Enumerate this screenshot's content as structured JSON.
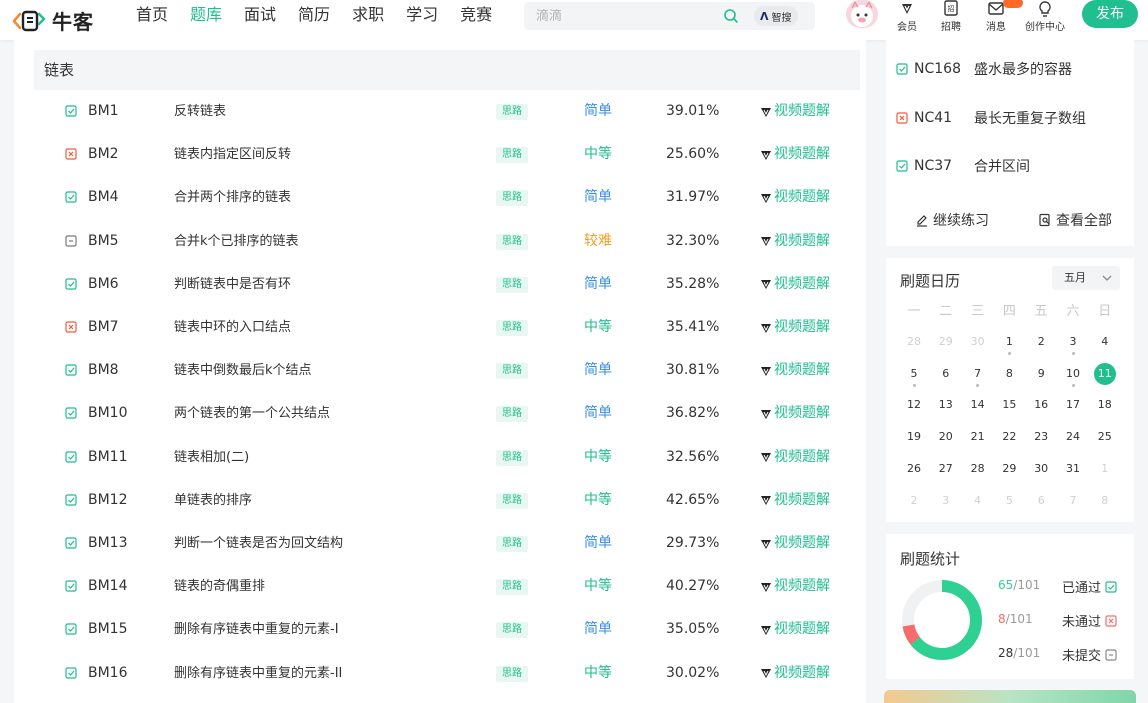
{
  "header": {
    "logo_text": "牛客",
    "nav": [
      {
        "label": "首页",
        "active": false
      },
      {
        "label": "题库",
        "active": true
      },
      {
        "label": "面试",
        "active": false
      },
      {
        "label": "简历",
        "active": false
      },
      {
        "label": "求职",
        "active": false
      },
      {
        "label": "学习",
        "active": false
      },
      {
        "label": "竞赛",
        "active": false
      }
    ],
    "search_placeholder": "滴滴",
    "zhisou_label": "智搜",
    "tools": {
      "vip": "会员",
      "recruit": "招聘",
      "message": "消息",
      "creator": "创作中心"
    },
    "publish_label": "发布",
    "accent": "#1fbf8f"
  },
  "list": {
    "section_title": "链表",
    "tag_label": "思路",
    "video_label": "视频题解",
    "rows": [
      {
        "status": "done",
        "id": "BM1",
        "title": "反转链表",
        "difficulty": "简单",
        "rate": "39.01%"
      },
      {
        "status": "fail",
        "id": "BM2",
        "title": "链表内指定区间反转",
        "difficulty": "中等",
        "rate": "25.60%"
      },
      {
        "status": "done",
        "id": "BM4",
        "title": "合并两个排序的链表",
        "difficulty": "简单",
        "rate": "31.97%"
      },
      {
        "status": "none",
        "id": "BM5",
        "title": "合并k个已排序的链表",
        "difficulty": "较难",
        "rate": "32.30%"
      },
      {
        "status": "done",
        "id": "BM6",
        "title": "判断链表中是否有环",
        "difficulty": "简单",
        "rate": "35.28%"
      },
      {
        "status": "fail",
        "id": "BM7",
        "title": "链表中环的入口结点",
        "difficulty": "中等",
        "rate": "35.41%"
      },
      {
        "status": "done",
        "id": "BM8",
        "title": "链表中倒数最后k个结点",
        "difficulty": "简单",
        "rate": "30.81%"
      },
      {
        "status": "done",
        "id": "BM10",
        "title": "两个链表的第一个公共结点",
        "difficulty": "简单",
        "rate": "36.82%"
      },
      {
        "status": "done",
        "id": "BM11",
        "title": "链表相加(二)",
        "difficulty": "中等",
        "rate": "32.56%"
      },
      {
        "status": "done",
        "id": "BM12",
        "title": "单链表的排序",
        "difficulty": "中等",
        "rate": "42.65%"
      },
      {
        "status": "done",
        "id": "BM13",
        "title": "判断一个链表是否为回文结构",
        "difficulty": "简单",
        "rate": "29.73%"
      },
      {
        "status": "done",
        "id": "BM14",
        "title": "链表的奇偶重排",
        "difficulty": "中等",
        "rate": "40.27%"
      },
      {
        "status": "done",
        "id": "BM15",
        "title": "删除有序链表中重复的元素-I",
        "difficulty": "简单",
        "rate": "35.05%"
      },
      {
        "status": "done",
        "id": "BM16",
        "title": "删除有序链表中重复的元素-II",
        "difficulty": "中等",
        "rate": "30.02%"
      }
    ],
    "difficulty_colors": {
      "简单": "#3a8ee6",
      "中等": "#1fbf8f",
      "较难": "#f0a020"
    }
  },
  "recommend": {
    "items": [
      {
        "status": "done",
        "id": "NC168",
        "title": "盛水最多的容器"
      },
      {
        "status": "fail",
        "id": "NC41",
        "title": "最长无重复子数组"
      },
      {
        "status": "done",
        "id": "NC37",
        "title": "合并区间"
      }
    ],
    "continue_label": "继续练习",
    "view_all_label": "查看全部"
  },
  "calendar": {
    "title": "刷题日历",
    "month": "五月",
    "weekdays": [
      "一",
      "二",
      "三",
      "四",
      "五",
      "六",
      "日"
    ],
    "weeks": [
      [
        {
          "d": "28",
          "dim": true
        },
        {
          "d": "29",
          "dim": true
        },
        {
          "d": "30",
          "dim": true
        },
        {
          "d": "1",
          "dot": true
        },
        {
          "d": "2"
        },
        {
          "d": "3",
          "dot": true
        },
        {
          "d": "4"
        }
      ],
      [
        {
          "d": "5",
          "dot": true
        },
        {
          "d": "6"
        },
        {
          "d": "7",
          "dot": true
        },
        {
          "d": "8"
        },
        {
          "d": "9"
        },
        {
          "d": "10",
          "dot": true
        },
        {
          "d": "11",
          "today": true
        }
      ],
      [
        {
          "d": "12"
        },
        {
          "d": "13"
        },
        {
          "d": "14"
        },
        {
          "d": "15"
        },
        {
          "d": "16"
        },
        {
          "d": "17"
        },
        {
          "d": "18"
        }
      ],
      [
        {
          "d": "19"
        },
        {
          "d": "20"
        },
        {
          "d": "21"
        },
        {
          "d": "22"
        },
        {
          "d": "23"
        },
        {
          "d": "24"
        },
        {
          "d": "25"
        }
      ],
      [
        {
          "d": "26"
        },
        {
          "d": "27"
        },
        {
          "d": "28"
        },
        {
          "d": "29"
        },
        {
          "d": "30"
        },
        {
          "d": "31"
        },
        {
          "d": "1",
          "dim": true
        }
      ],
      [
        {
          "d": "2",
          "dim": true
        },
        {
          "d": "3",
          "dim": true
        },
        {
          "d": "4",
          "dim": true
        },
        {
          "d": "5",
          "dim": true
        },
        {
          "d": "6",
          "dim": true
        },
        {
          "d": "7",
          "dim": true
        },
        {
          "d": "8",
          "dim": true
        }
      ]
    ]
  },
  "stats": {
    "title": "刷题统计",
    "total": 101,
    "passed": {
      "count": 65,
      "label": "已通过",
      "color": "#2ed191"
    },
    "failed": {
      "count": 8,
      "label": "未通过",
      "color": "#f56c6c"
    },
    "unsubmitted": {
      "count": 28,
      "label": "未提交",
      "color": "#f0f1f3"
    }
  }
}
